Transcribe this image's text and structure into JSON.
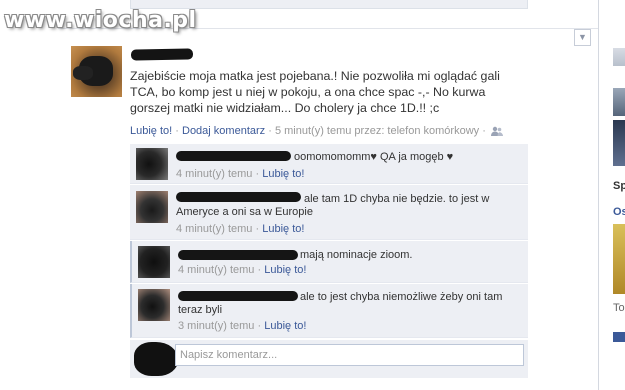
{
  "watermark": "www.wiocha.pl",
  "post": {
    "text": "Zajebiście moja matka jest pojebana.! Nie pozwoliła mi oglądać gali TCA, bo komp jest u niej w pokoju, a ona chce spac -,- No kurwa gorszej matki nie widziałam... Do cholery ja chce 1D.!! ;c",
    "like_label": "Lubię to!",
    "comment_label": "Dodaj komentarz",
    "time": "5 minut(y) temu przez: telefon komórkowy",
    "separator": "·"
  },
  "comments": [
    {
      "text": "oomomomomm♥ QA ja mogęb ♥",
      "time": "4 minut(y) temu",
      "like": "Lubię to!"
    },
    {
      "text": "ale tam 1D chyba nie będzie. to jest w Ameryce a oni sa w Europie",
      "time": "4 minut(y) temu",
      "like": "Lubię to!"
    },
    {
      "text": "mają nominacje zioom.",
      "time": "4 minut(y) temu",
      "like": "Lubię to!"
    },
    {
      "text": "ale to jest chyba niemożliwe żeby oni tam teraz byli",
      "time": "3 minut(y) temu",
      "like": "Lubię to!"
    }
  ],
  "write_comment": {
    "placeholder": "Napisz komentarz..."
  },
  "sidebar": {
    "labels": [
      "Sp",
      "Os",
      "To"
    ],
    "accent": "#3b5998"
  }
}
